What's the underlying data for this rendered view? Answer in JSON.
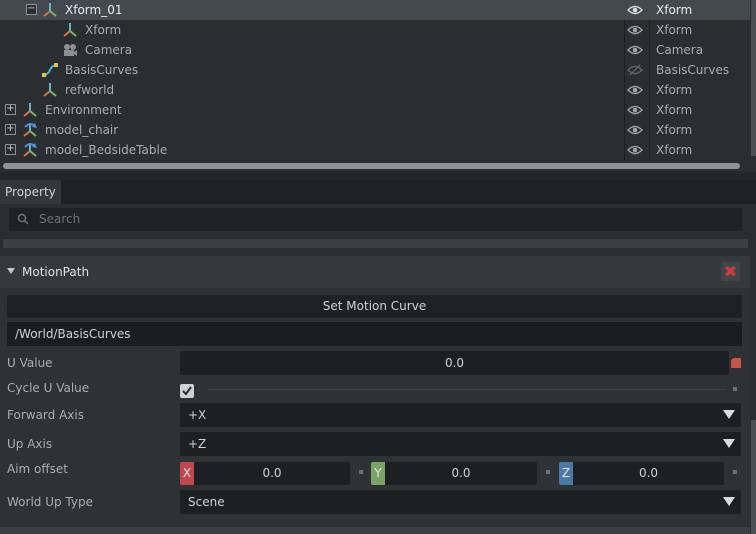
{
  "stage": {
    "rows": [
      {
        "name": "Xform_01",
        "type": "Xform",
        "expander": "−",
        "selected": true
      },
      {
        "name": "Xform",
        "type": "Xform"
      },
      {
        "name": "Camera",
        "type": "Camera"
      },
      {
        "name": "BasisCurves",
        "type": "BasisCurves",
        "hidden": true
      },
      {
        "name": "refworld",
        "type": "Xform"
      },
      {
        "name": "Environment",
        "type": "Xform",
        "expander": "+"
      },
      {
        "name": "model_chair",
        "type": "Xform",
        "expander": "+"
      },
      {
        "name": "model_BedsideTable",
        "type": "Xform",
        "expander": "+"
      }
    ]
  },
  "property": {
    "tab_label": "Property",
    "search_placeholder": "Search",
    "motion_path": {
      "title": "MotionPath",
      "set_curve_label": "Set Motion Curve",
      "curve_path": "/World/BasisCurves",
      "u_value_label": "U Value",
      "u_value": "0.0",
      "cycle_label": "Cycle U Value",
      "cycle_checked": true,
      "forward_axis_label": "Forward Axis",
      "forward_axis": "+X",
      "up_axis_label": "Up Axis",
      "up_axis": "+Z",
      "aim_offset_label": "Aim offset",
      "aim_x_label": "X",
      "aim_x": "0.0",
      "aim_y_label": "Y",
      "aim_y": "0.0",
      "aim_z_label": "Z",
      "aim_z": "0.0",
      "world_up_label": "World Up Type",
      "world_up": "Scene"
    }
  },
  "colors": {
    "axis_x": "#c0474b",
    "axis_y": "#7aa466",
    "axis_z": "#4a79a8",
    "close": "#d23a3a"
  }
}
